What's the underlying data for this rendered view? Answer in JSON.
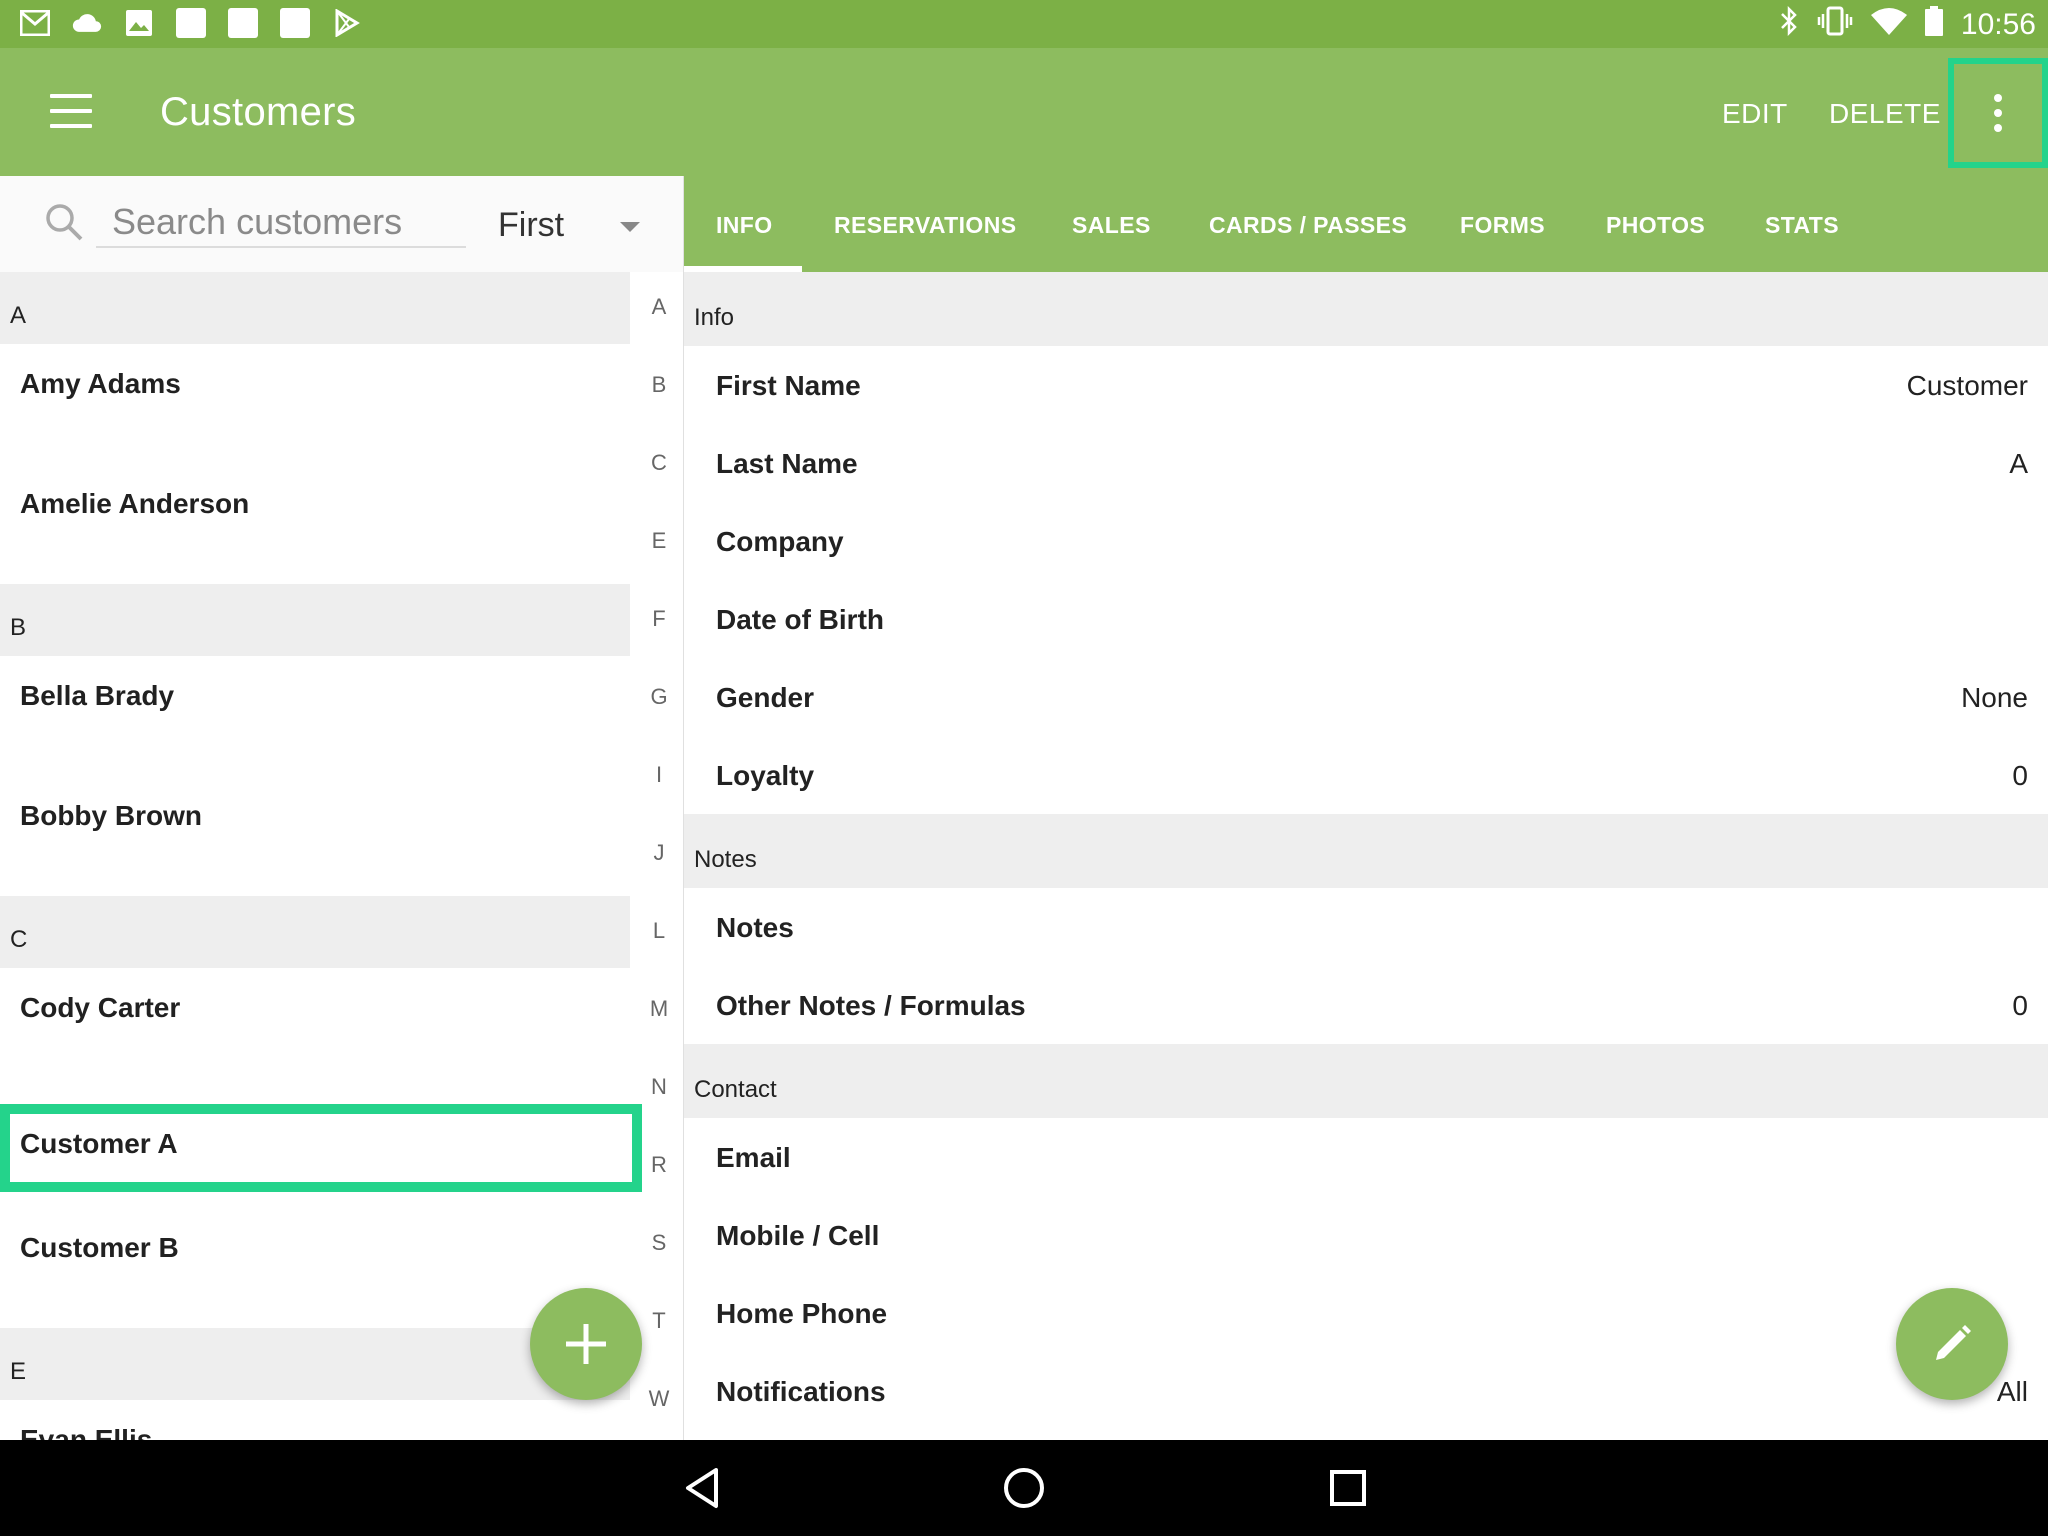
{
  "status_bar": {
    "icons_left": [
      "gmail-icon",
      "cloud-icon",
      "image-icon",
      "blank-notification-icon",
      "blank-notification-icon",
      "blank-notification-icon",
      "play-store-icon"
    ],
    "icons_right": [
      "bluetooth-icon",
      "vibrate-icon",
      "wifi-icon",
      "battery-icon"
    ],
    "time": "10:56"
  },
  "app_bar": {
    "title": "Customers",
    "edit_label": "EDIT",
    "delete_label": "DELETE"
  },
  "search": {
    "placeholder": "Search customers",
    "sort_value": "First"
  },
  "customer_list": {
    "sections": [
      {
        "letter": "A",
        "items": [
          "Amy Adams",
          "Amelie Anderson"
        ]
      },
      {
        "letter": "B",
        "items": [
          "Bella Brady",
          "Bobby Brown"
        ]
      },
      {
        "letter": "C",
        "items": [
          "Cody Carter",
          "Customer A",
          "Customer B"
        ]
      },
      {
        "letter": "E",
        "items": [
          "Evan Ellis"
        ]
      }
    ],
    "selected": "Customer A"
  },
  "alpha_index": [
    "A",
    "B",
    "C",
    "E",
    "F",
    "G",
    "I",
    "J",
    "L",
    "M",
    "N",
    "R",
    "S",
    "T",
    "W"
  ],
  "tabs": [
    "INFO",
    "RESERVATIONS",
    "SALES",
    "CARDS / PASSES",
    "FORMS",
    "PHOTOS",
    "STATS"
  ],
  "active_tab": "INFO",
  "detail": {
    "info_section": "Info",
    "first_name_label": "First Name",
    "first_name_value": "Customer",
    "last_name_label": "Last Name",
    "last_name_value": "A",
    "company_label": "Company",
    "dob_label": "Date of Birth",
    "gender_label": "Gender",
    "gender_value": "None",
    "loyalty_label": "Loyalty",
    "loyalty_value": "0",
    "notes_section": "Notes",
    "notes_label": "Notes",
    "other_notes_label": "Other Notes / Formulas",
    "other_notes_value": "0",
    "contact_section": "Contact",
    "email_label": "Email",
    "mobile_label": "Mobile / Cell",
    "home_phone_label": "Home Phone",
    "notifications_label": "Notifications",
    "notifications_value": "All"
  },
  "colors": {
    "status_bar": "#7cb046",
    "app_bar": "#8dbc5f",
    "highlight": "#24d38b"
  }
}
